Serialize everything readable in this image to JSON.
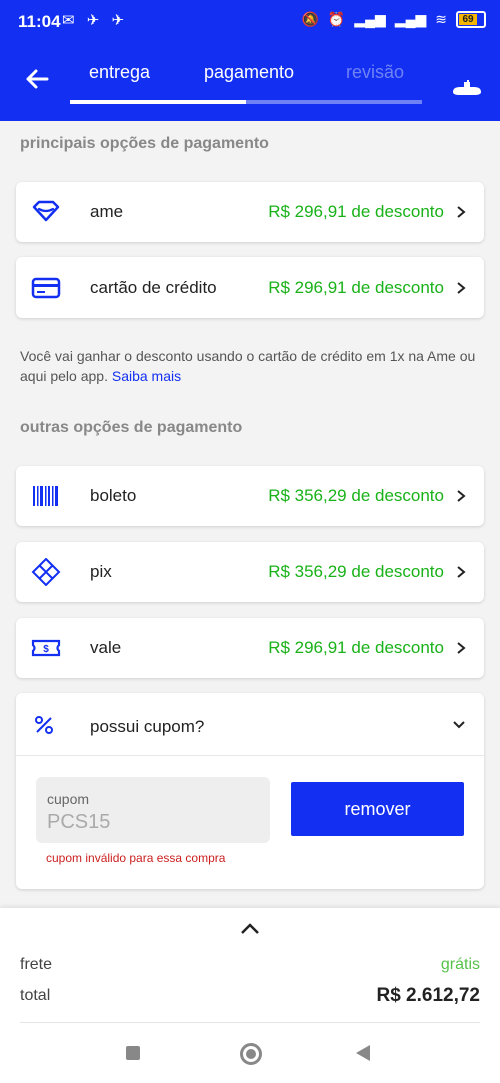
{
  "status": {
    "time": "11:04",
    "left_icons": "✉ ✈ ✈",
    "battery": "69"
  },
  "header": {
    "tabs": [
      {
        "label": "entrega"
      },
      {
        "label": "pagamento"
      },
      {
        "label": "revisão"
      }
    ],
    "progress_fraction": 0.5
  },
  "main_section_title": "principais opções de pagamento",
  "main_options": [
    {
      "label": "ame",
      "discount": "R$ 296,91 de desconto",
      "icon": "ame-icon"
    },
    {
      "label": "cartão de crédito",
      "discount": "R$ 296,91 de desconto",
      "icon": "credit-card-icon"
    }
  ],
  "info": {
    "text": "Você vai ganhar o desconto usando o cartão de crédito em 1x na Ame ou aqui pelo app.",
    "link": "Saiba mais"
  },
  "other_section_title": "outras opções de pagamento",
  "other_options": [
    {
      "label": "boleto",
      "discount": "R$ 356,29 de desconto",
      "icon": "barcode-icon"
    },
    {
      "label": "pix",
      "discount": "R$ 356,29 de desconto",
      "icon": "pix-icon"
    },
    {
      "label": "vale",
      "discount": "R$ 296,91 de desconto",
      "icon": "voucher-icon"
    }
  ],
  "coupon": {
    "title": "possui cupom?",
    "field_label": "cupom",
    "field_value": "PCS15",
    "error": "cupom inválido para essa compra",
    "button": "remover"
  },
  "summary": {
    "frete_label": "frete",
    "frete_value": "grátis",
    "total_label": "total",
    "total_value": "R$ 2.612,72"
  },
  "colors": {
    "brand": "#1330f2",
    "discount": "#19b219",
    "error": "#cc1f1f"
  }
}
